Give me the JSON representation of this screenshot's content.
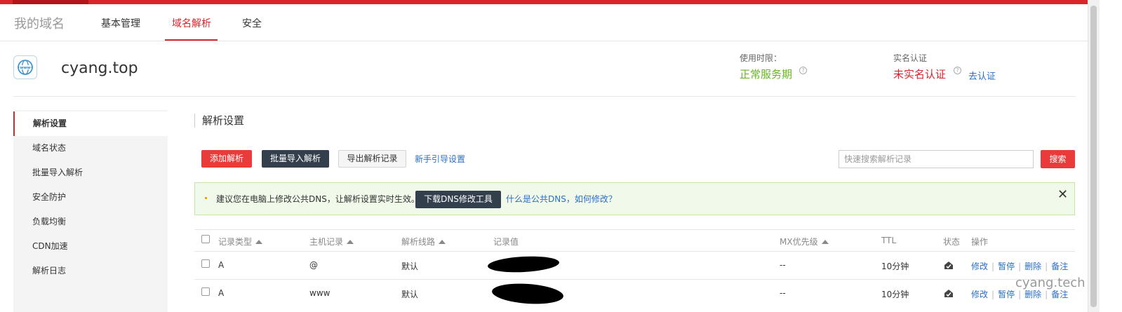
{
  "nav": {
    "brand": "我的域名",
    "tabs": [
      {
        "label": "基本管理"
      },
      {
        "label": "域名解析"
      },
      {
        "label": "安全"
      }
    ]
  },
  "domain": {
    "name": "cyang.top",
    "service_label": "使用时限：",
    "service_status": "正常服务期",
    "verify_label": "实名认证",
    "verify_status": "未实名认证",
    "verify_link": "去认证"
  },
  "sidebar": {
    "items": [
      {
        "label": "解析设置"
      },
      {
        "label": "域名状态"
      },
      {
        "label": "批量导入解析"
      },
      {
        "label": "安全防护"
      },
      {
        "label": "负载均衡"
      },
      {
        "label": "CDN加速"
      },
      {
        "label": "解析日志"
      }
    ]
  },
  "main": {
    "title": "解析设置",
    "add_btn": "添加解析",
    "batch_btn": "批量导入解析",
    "export_btn": "导出解析记录",
    "guide_link": "新手引导设置",
    "search_placeholder": "快速搜索解析记录",
    "search_btn": "搜索"
  },
  "notice": {
    "text": "建议您在电脑上修改公共DNS，让解析设置实时生效。",
    "download_btn": "下载DNS修改工具",
    "help_link": "什么是公共DNS，如何修改？",
    "close": "✕"
  },
  "table": {
    "headers": {
      "type": "记录类型",
      "host": "主机记录",
      "line": "解析线路",
      "value": "记录值",
      "mx": "MX优先级",
      "ttl": "TTL",
      "status": "状态",
      "ops": "操作"
    },
    "rows": [
      {
        "type": "A",
        "host": "@",
        "line": "默认",
        "mx": "--",
        "ttl": "10分钟"
      },
      {
        "type": "A",
        "host": "www",
        "line": "默认",
        "mx": "--",
        "ttl": "10分钟"
      }
    ],
    "ops": {
      "edit": "修改",
      "pause": "暂停",
      "delete": "删除",
      "note": "备注"
    }
  },
  "watermark": "cyang.tech",
  "colors": {
    "accent": "#d9262c",
    "ok": "#67b626",
    "link": "#2a6fc9",
    "dark_btn": "#343f4d"
  }
}
